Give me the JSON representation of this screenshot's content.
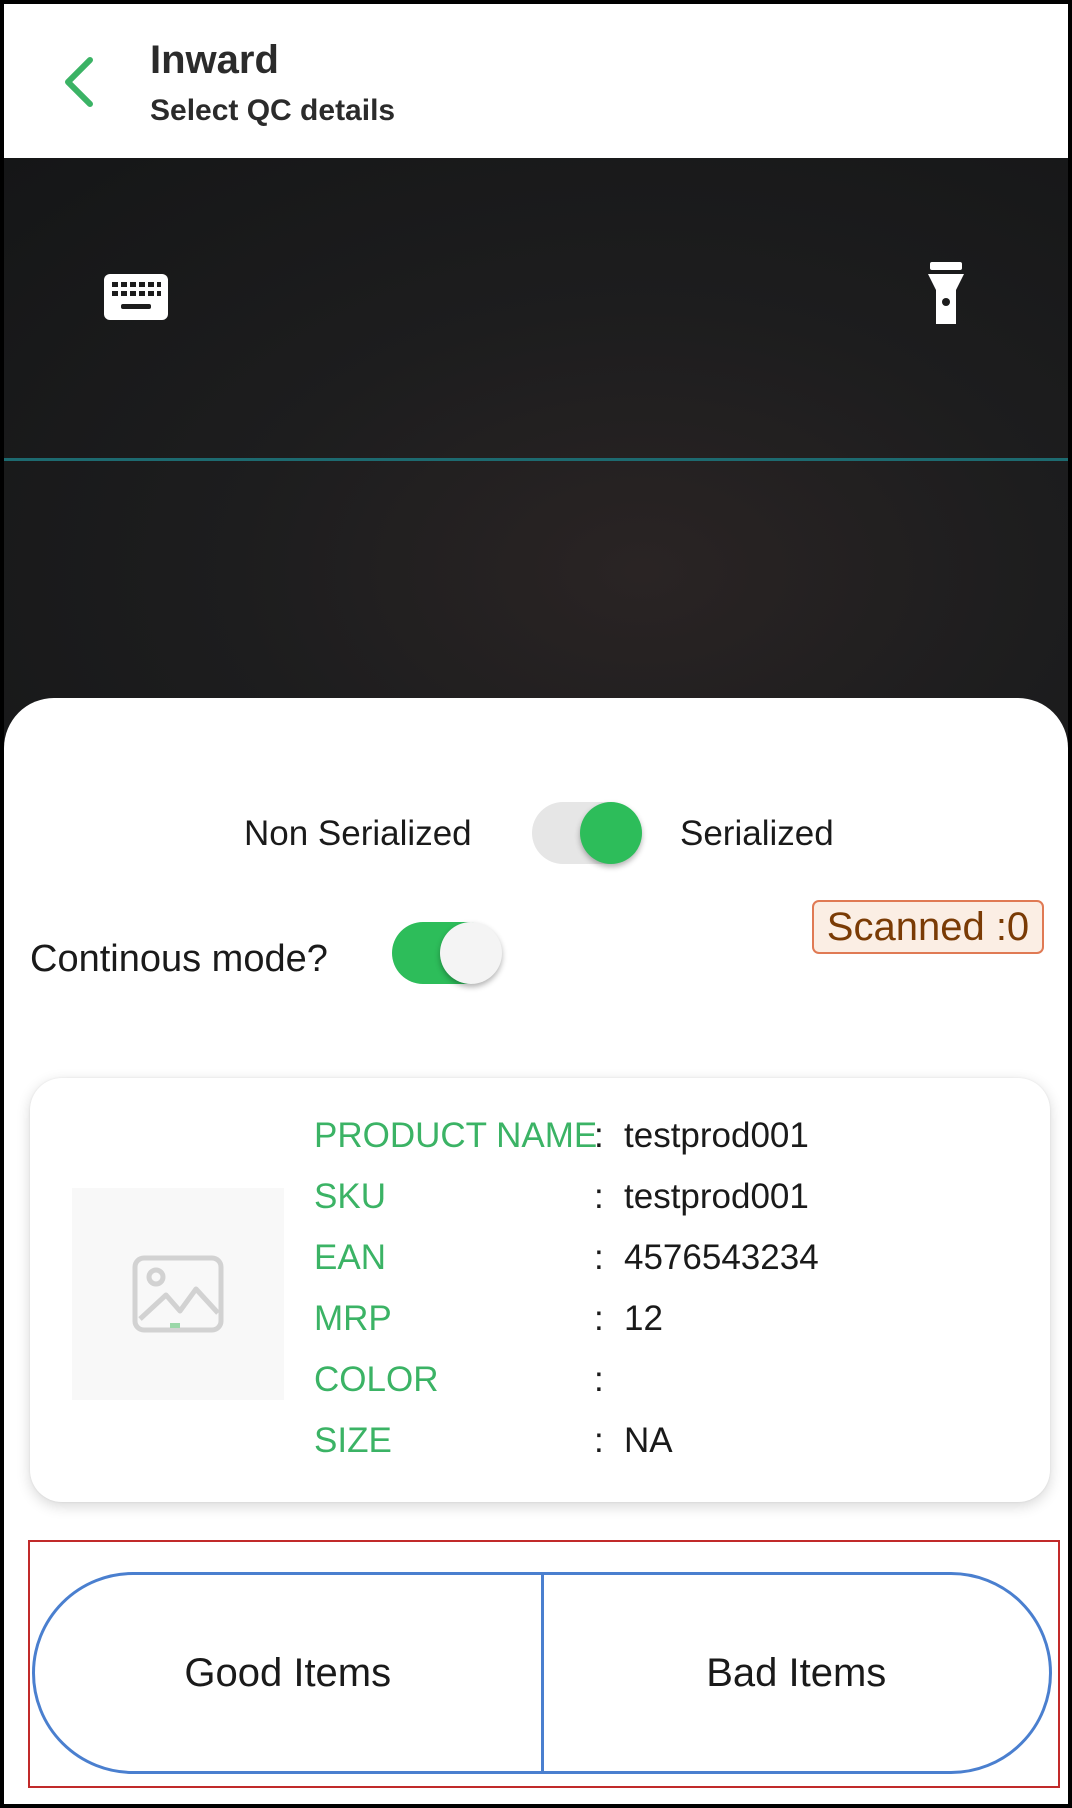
{
  "header": {
    "title": "Inward",
    "subtitle": "Select QC details"
  },
  "camera": {
    "keyboard_icon": "keyboard-icon",
    "torch_icon": "flashlight-icon"
  },
  "mode_toggle": {
    "left_label": "Non Serialized",
    "right_label": "Serialized",
    "state": "Serialized"
  },
  "continuous": {
    "label": "Continous mode?",
    "enabled": true
  },
  "scanned": {
    "text": "Scanned :0"
  },
  "product": {
    "image_icon": "image-placeholder-icon",
    "fields": [
      {
        "label": "PRODUCT NAME",
        "sep": ":",
        "value": "testprod001"
      },
      {
        "label": "SKU",
        "sep": ":",
        "value": "testprod001"
      },
      {
        "label": "EAN",
        "sep": ":",
        "value": "4576543234"
      },
      {
        "label": "MRP",
        "sep": ":",
        "value": "12"
      },
      {
        "label": "COLOR",
        "sep": ":",
        "value": ""
      },
      {
        "label": "SIZE",
        "sep": ":",
        "value": "NA"
      }
    ]
  },
  "actions": {
    "good_label": "Good Items",
    "bad_label": "Bad Items"
  },
  "colors": {
    "accent_green": "#3bb365",
    "toggle_green": "#2dbd5a",
    "button_border": "#4a7fcf",
    "badge_border": "#e07a54",
    "badge_text": "#7a3b05"
  }
}
